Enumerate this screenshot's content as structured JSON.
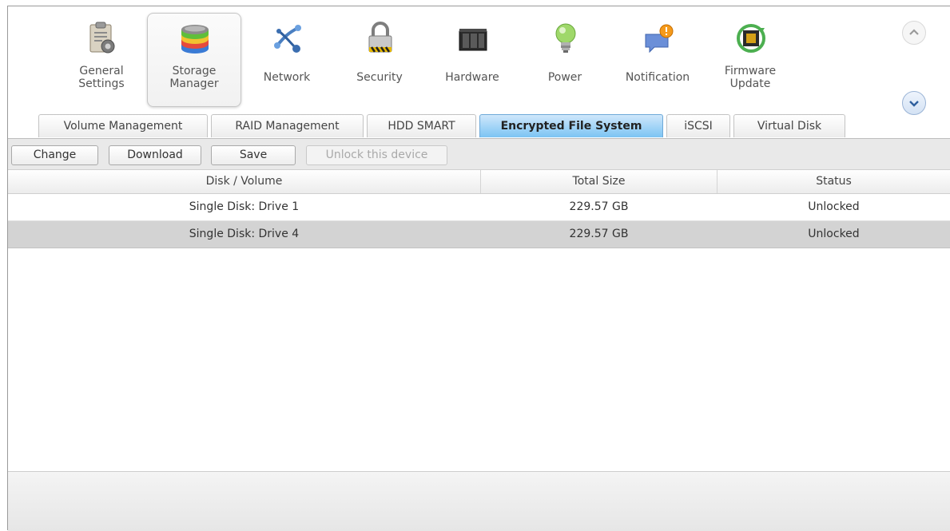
{
  "categories": [
    {
      "label": "General\nSettings",
      "icon": "general-settings-icon"
    },
    {
      "label": "Storage\nManager",
      "icon": "storage-manager-icon"
    },
    {
      "label": "Network",
      "icon": "network-icon"
    },
    {
      "label": "Security",
      "icon": "padlock-icon"
    },
    {
      "label": "Hardware",
      "icon": "hardware-icon"
    },
    {
      "label": "Power",
      "icon": "bulb-icon"
    },
    {
      "label": "Notification",
      "icon": "notification-icon"
    },
    {
      "label": "Firmware\nUpdate",
      "icon": "firmware-update-icon"
    }
  ],
  "tabs": [
    {
      "label": "Volume Management"
    },
    {
      "label": "RAID Management"
    },
    {
      "label": "HDD SMART"
    },
    {
      "label": "Encrypted File System"
    },
    {
      "label": "iSCSI"
    },
    {
      "label": "Virtual Disk"
    }
  ],
  "toolbar": {
    "change": "Change",
    "download": "Download",
    "save": "Save",
    "unlock": "Unlock this device"
  },
  "table": {
    "columns": [
      "Disk / Volume",
      "Total Size",
      "Status"
    ],
    "rows": [
      {
        "disk": "Single Disk: Drive 1",
        "size": "229.57 GB",
        "status": "Unlocked"
      },
      {
        "disk": "Single Disk: Drive 4",
        "size": "229.57 GB",
        "status": "Unlocked"
      }
    ]
  },
  "colors": {
    "active_tab": "#7cc4f3",
    "selected_row": "#d3d3d3"
  }
}
